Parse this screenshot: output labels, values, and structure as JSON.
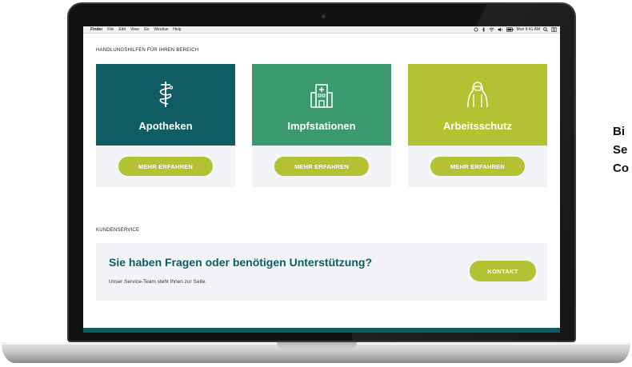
{
  "menubar": {
    "apple": "",
    "items": [
      "Finder",
      "File",
      "Edit",
      "View",
      "Go",
      "Window",
      "Help"
    ],
    "clock": "Mon 9:41 AM"
  },
  "page": {
    "section_title": "HANDLUNGSHILFEN FÜR IHREN BEREICH",
    "cards": [
      {
        "title": "Apotheken",
        "button": "MEHR ERFAHREN",
        "icon": "caduceus-icon",
        "color": "#0f5c62"
      },
      {
        "title": "Impfstationen",
        "button": "MEHR ERFAHREN",
        "icon": "hospital-icon",
        "color": "#3a9a6e"
      },
      {
        "title": "Arbeitsschutz",
        "button": "MEHR ERFAHREN",
        "icon": "protective-suit-icon",
        "color": "#b3c232"
      }
    ],
    "kundenservice_label": "KUNDENSERVICE",
    "service_title": "Sie haben Fragen oder benötigen Unterstützung?",
    "service_sub": "Unser Service-Team steht Ihnen zur Seite.",
    "contact_button": "KONTAKT"
  },
  "side_text": [
    "Bi",
    "Se",
    "Co"
  ],
  "accent_colors": {
    "teal": "#0f5c62",
    "green": "#3a9a6e",
    "lime": "#b3c232"
  }
}
